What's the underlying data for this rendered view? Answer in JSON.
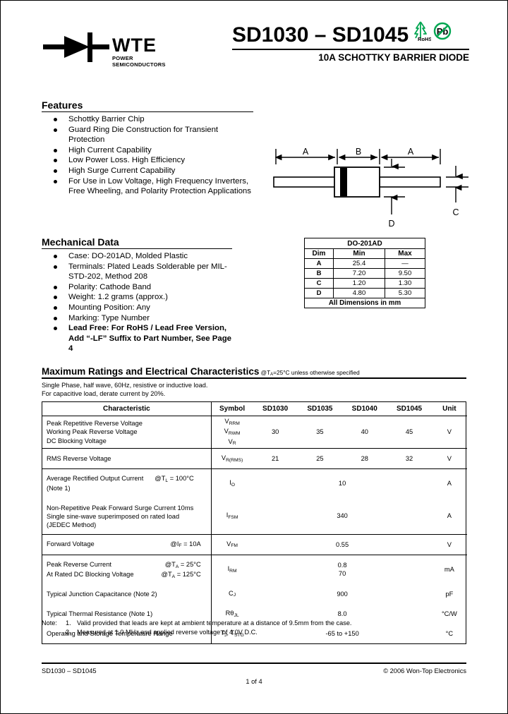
{
  "header": {
    "logo_text": "WTE",
    "logo_sub": "POWER SEMICONDUCTORS",
    "part_title": "SD1030 – SD1045",
    "subtitle": "10A SCHOTTKY BARRIER DIODE",
    "rohs_label": "RoHS",
    "pb_label": "Pb"
  },
  "features": {
    "heading": "Features",
    "items": [
      "Schottky Barrier Chip",
      "Guard Ring Die Construction for Transient Protection",
      "High Current Capability",
      "Low Power Loss. High Efficiency",
      "High Surge Current Capability",
      "For Use in Low Voltage, High Frequency Inverters, Free Wheeling, and Polarity Protection Applications"
    ]
  },
  "mechanical": {
    "heading": "Mechanical Data",
    "items": [
      "Case: DO-201AD, Molded Plastic",
      "Terminals: Plated Leads Solderable per MIL-STD-202, Method 208",
      "Polarity: Cathode Band",
      "Weight: 1.2 grams (approx.)",
      "Mounting Position: Any",
      "Marking: Type Number",
      "Lead Free: For RoHS / Lead Free Version, Add “-LF” Suffix to Part Number, See Page 4"
    ]
  },
  "drawing": {
    "labels": [
      "A",
      "B",
      "A",
      "C",
      "D"
    ]
  },
  "dim_table": {
    "caption": "DO-201AD",
    "headers": [
      "Dim",
      "Min",
      "Max"
    ],
    "rows": [
      [
        "A",
        "25.4",
        "—"
      ],
      [
        "B",
        "7.20",
        "9.50"
      ],
      [
        "C",
        "1.20",
        "1.30"
      ],
      [
        "D",
        "4.80",
        "5.30"
      ]
    ],
    "footer": "All Dimensions in mm"
  },
  "max_ratings": {
    "title": "Maximum Ratings and Electrical Characteristics",
    "condition": "@TA=25°C unless otherwise specified",
    "note_line1": "Single Phase, half wave, 60Hz, resistive or inductive load.",
    "note_line2": "For capacitive load, derate current by 20%.",
    "headers": [
      "Characteristic",
      "Symbol",
      "SD1030",
      "SD1035",
      "SD1040",
      "SD1045",
      "Unit"
    ],
    "rows": [
      {
        "characteristic": [
          "Peak Repetitive Reverse Voltage",
          "Working Peak Reverse Voltage",
          "DC Blocking Voltage"
        ],
        "conditions": [
          "",
          "",
          ""
        ],
        "symbol": [
          "VRRM",
          "VRWM",
          "VR"
        ],
        "values": [
          "30",
          "35",
          "40",
          "45"
        ],
        "span": false,
        "unit": "V",
        "divider": true
      },
      {
        "characteristic": [
          "RMS Reverse Voltage"
        ],
        "conditions": [
          ""
        ],
        "symbol": [
          "VR(RMS)"
        ],
        "values": [
          "21",
          "25",
          "28",
          "32"
        ],
        "span": false,
        "unit": "V",
        "divider": true
      },
      {
        "characteristic": [
          "Average Rectified Output Current",
          "(Note 1)"
        ],
        "conditions": [
          "@TL = 100°C",
          ""
        ],
        "symbol": [
          "IO"
        ],
        "values": [
          "10"
        ],
        "span": true,
        "unit": "A",
        "divider": false
      },
      {
        "characteristic": [
          "Non-Repetitive Peak Forward Surge Current 10ms",
          "Single sine-wave superimposed on rated load",
          "(JEDEC Method)"
        ],
        "conditions": [
          "",
          "",
          ""
        ],
        "symbol": [
          "IFSM"
        ],
        "values": [
          "340"
        ],
        "span": true,
        "unit": "A",
        "divider": true
      },
      {
        "characteristic": [
          "Forward Voltage"
        ],
        "conditions": [
          "@IF = 10A"
        ],
        "symbol": [
          "VFM"
        ],
        "values": [
          "0.55"
        ],
        "span": true,
        "unit": "V",
        "divider": true
      },
      {
        "characteristic": [
          "Peak Reverse Current",
          "At Rated DC Blocking Voltage"
        ],
        "conditions": [
          "@TA = 25°C",
          "@TA = 125°C"
        ],
        "symbol": [
          "IRM"
        ],
        "values": [
          "0.8\n70"
        ],
        "span": true,
        "unit": "mA",
        "divider": false
      },
      {
        "characteristic": [
          "Typical Junction Capacitance (Note 2)"
        ],
        "conditions": [
          ""
        ],
        "symbol": [
          "CJ"
        ],
        "values": [
          "900"
        ],
        "span": true,
        "unit": "pF",
        "divider": false
      },
      {
        "characteristic": [
          "Typical Thermal Resistance (Note 1)"
        ],
        "conditions": [
          ""
        ],
        "symbol": [
          "RθJL"
        ],
        "values": [
          "8.0"
        ],
        "span": true,
        "unit": "°C/W",
        "divider": false
      },
      {
        "characteristic": [
          "Operating and Storage Temperature Range"
        ],
        "conditions": [
          ""
        ],
        "symbol": [
          "TJ, TSTG"
        ],
        "values": [
          "-65 to +150"
        ],
        "span": true,
        "unit": "°C",
        "divider": false
      }
    ]
  },
  "notes": {
    "label": "Note:",
    "items": [
      {
        "num": "1.",
        "text": "Valid provided that leads are kept at ambient temperature at a distance of 9.5mm from the case."
      },
      {
        "num": "2.",
        "text": "Measured at 1.0 MHz and applied reverse voltage of 4.0V D.C."
      }
    ]
  },
  "footer": {
    "left": "SD1030 – SD1045",
    "center": "1 of 4",
    "right": "© 2006 Won-Top Electronics"
  },
  "colors": {
    "rohs_green": "#00A651",
    "text": "#000000",
    "background": "#FFFFFF"
  }
}
